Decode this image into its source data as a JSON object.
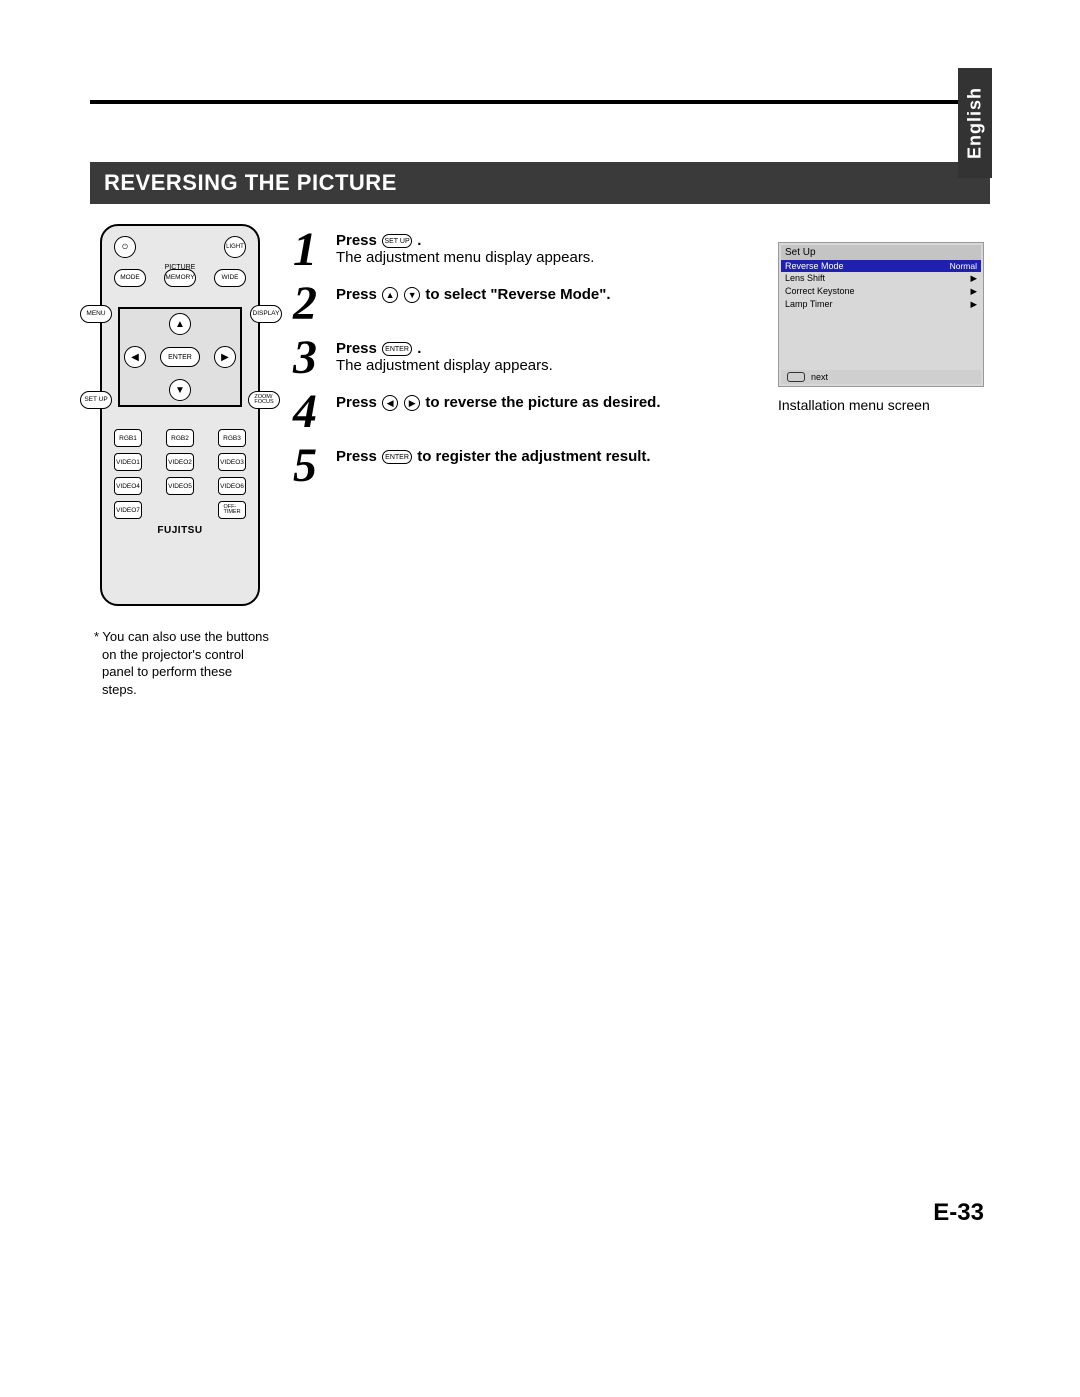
{
  "language_tab": "English",
  "section_title": "REVERSING THE PICTURE",
  "remote": {
    "power_icon": "⏻",
    "light": "LIGHT",
    "picture_label": "PICTURE",
    "mode": "MODE",
    "memory": "MEMORY",
    "wide": "WIDE",
    "menu": "MENU",
    "display": "DISPLAY",
    "enter": "ENTER",
    "setup": "SET UP",
    "zoom_focus": "ZOOM/\nFOCUS",
    "rgb1": "RGB1",
    "rgb2": "RGB2",
    "rgb3": "RGB3",
    "video1": "VIDEO1",
    "video2": "VIDEO2",
    "video3": "VIDEO3",
    "video4": "VIDEO4",
    "video5": "VIDEO5",
    "video6": "VIDEO6",
    "video7": "VIDEO7",
    "off_timer": "OFF-\nTIMER",
    "brand": "FUJITSU"
  },
  "note": "* You can also use the buttons on the projector's control panel to perform these steps.",
  "steps": [
    {
      "num": "1",
      "lead": "Press",
      "btn_label": "SET UP",
      "tail": ".",
      "body": "The adjustment menu display appears."
    },
    {
      "num": "2",
      "lead": "Press",
      "tail": "to select \"Reverse Mode\".",
      "arrows": [
        "▲",
        "▼"
      ]
    },
    {
      "num": "3",
      "lead": "Press",
      "btn_label": "ENTER",
      "tail": ".",
      "body": "The adjustment display appears."
    },
    {
      "num": "4",
      "lead": "Press",
      "tail": "to reverse the picture as desired.",
      "arrows": [
        "◀",
        "▶"
      ]
    },
    {
      "num": "5",
      "lead": "Press",
      "btn_label": "ENTER",
      "tail": "to register the adjustment result."
    }
  ],
  "menu": {
    "header": "Set Up",
    "rows": [
      {
        "label": "Reverse Mode",
        "value": "Normal",
        "active": true
      },
      {
        "label": "Lens Shift",
        "value": "▶"
      },
      {
        "label": "Correct Keystone",
        "value": "▶"
      },
      {
        "label": "Lamp Timer",
        "value": "▶"
      }
    ],
    "foot": "next",
    "caption": "Installation menu screen"
  },
  "page_number": "E-33"
}
